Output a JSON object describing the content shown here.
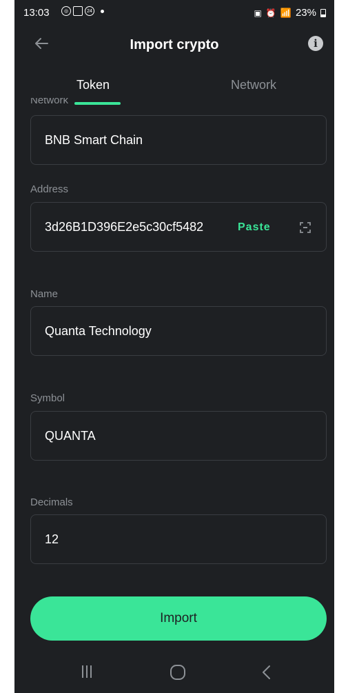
{
  "status_bar": {
    "time": "13:03",
    "battery": "23%",
    "notification_badge": "24"
  },
  "header": {
    "title": "Import crypto",
    "info_symbol": "i"
  },
  "tabs": [
    {
      "label": "Token",
      "active": true
    },
    {
      "label": "Network",
      "active": false
    }
  ],
  "form": {
    "network_label": "Network",
    "network_value": "BNB Smart Chain",
    "address_label": "Address",
    "address_value": "3d26B1D396E2e5c30cf5482",
    "paste_label": "Paste",
    "name_label": "Name",
    "name_value": "Quanta Technology",
    "symbol_label": "Symbol",
    "symbol_value": "QUANTA",
    "decimals_label": "Decimals",
    "decimals_value": "12"
  },
  "import_button": "Import",
  "colors": {
    "accent": "#3ae598",
    "background": "#1e2023",
    "muted_text": "#8d9196",
    "field_border": "#3a3d42"
  },
  "icons": {
    "back": "arrow-left-icon",
    "info": "info-icon",
    "scan": "scan-icon",
    "nav_recents": "recents-icon",
    "nav_home": "home-icon",
    "nav_back": "chevron-left-icon"
  }
}
